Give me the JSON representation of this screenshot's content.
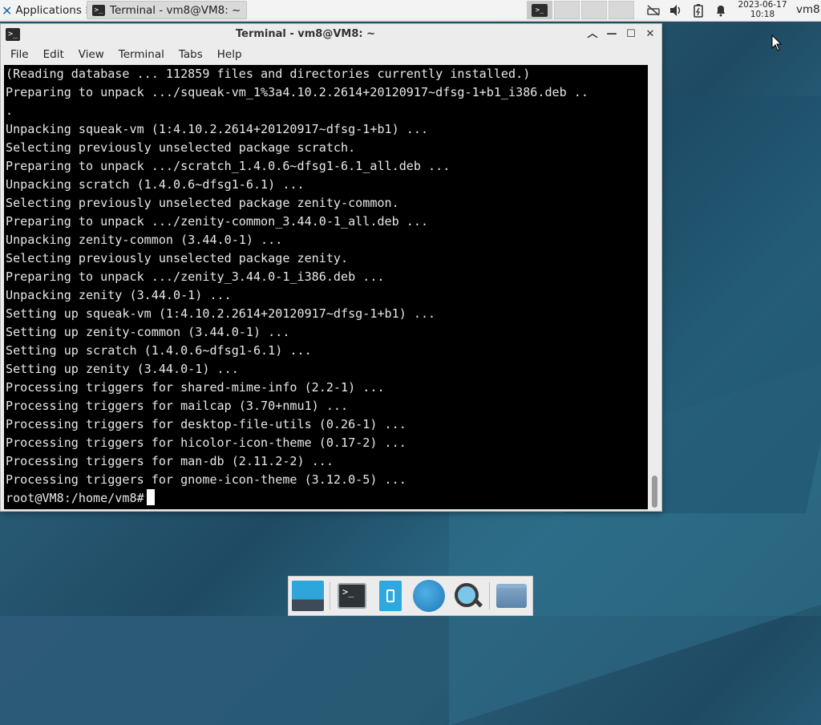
{
  "top_panel": {
    "applications_label": "Applications",
    "task_title": "Terminal - vm8@VM8: ~",
    "clock_date": "2023-06-17",
    "clock_time": "10:18",
    "user": "vm8"
  },
  "window": {
    "title": "Terminal - vm8@VM8: ~",
    "menu": [
      "File",
      "Edit",
      "View",
      "Terminal",
      "Tabs",
      "Help"
    ]
  },
  "terminal": {
    "lines": [
      "(Reading database ... 112859 files and directories currently installed.)",
      "Preparing to unpack .../squeak-vm_1%3a4.10.2.2614+20120917~dfsg-1+b1_i386.deb ..",
      ".",
      "Unpacking squeak-vm (1:4.10.2.2614+20120917~dfsg-1+b1) ...",
      "Selecting previously unselected package scratch.",
      "Preparing to unpack .../scratch_1.4.0.6~dfsg1-6.1_all.deb ...",
      "Unpacking scratch (1.4.0.6~dfsg1-6.1) ...",
      "Selecting previously unselected package zenity-common.",
      "Preparing to unpack .../zenity-common_3.44.0-1_all.deb ...",
      "Unpacking zenity-common (3.44.0-1) ...",
      "Selecting previously unselected package zenity.",
      "Preparing to unpack .../zenity_3.44.0-1_i386.deb ...",
      "Unpacking zenity (3.44.0-1) ...",
      "Setting up squeak-vm (1:4.10.2.2614+20120917~dfsg-1+b1) ...",
      "Setting up zenity-common (3.44.0-1) ...",
      "Setting up scratch (1.4.0.6~dfsg1-6.1) ...",
      "Setting up zenity (3.44.0-1) ...",
      "Processing triggers for shared-mime-info (2.2-1) ...",
      "Processing triggers for mailcap (3.70+nmu1) ...",
      "Processing triggers for desktop-file-utils (0.26-1) ...",
      "Processing triggers for hicolor-icon-theme (0.17-2) ...",
      "Processing triggers for man-db (2.11.2-2) ...",
      "Processing triggers for gnome-icon-theme (3.12.0-5) ..."
    ],
    "prompt": "root@VM8:/home/vm8#"
  },
  "dock": {
    "items": [
      "show-desktop-icon",
      "terminal-icon",
      "file-manager-icon",
      "web-browser-icon",
      "app-finder-icon",
      "folder-icon"
    ]
  }
}
